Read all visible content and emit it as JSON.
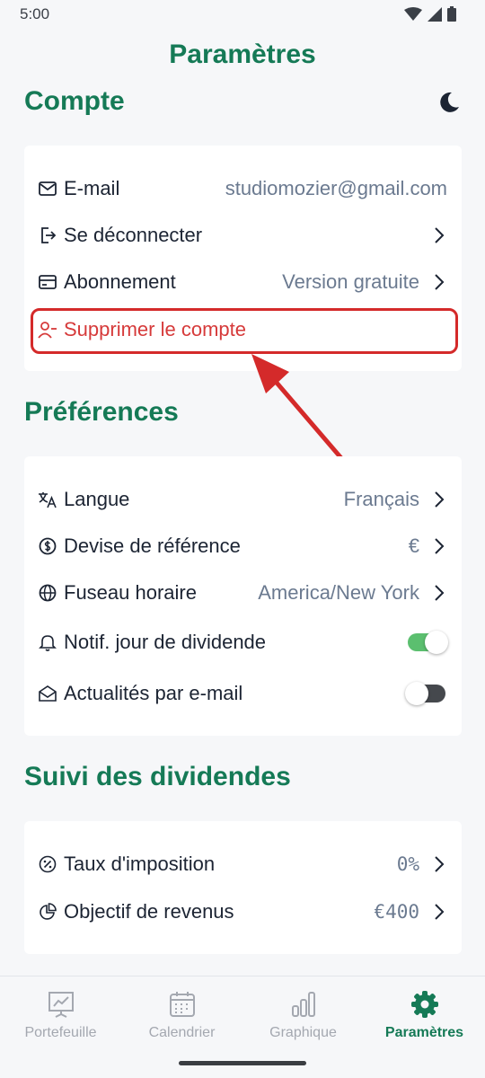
{
  "status_bar": {
    "time": "5:00"
  },
  "page_title": "Paramètres",
  "account": {
    "title": "Compte",
    "email_label": "E-mail",
    "email_value": "studiomozier@gmail.com",
    "logout_label": "Se déconnecter",
    "subscription_label": "Abonnement",
    "subscription_value": "Version gratuite",
    "delete_label": "Supprimer le compte"
  },
  "preferences": {
    "title": "Préférences",
    "language_label": "Langue",
    "language_value": "Français",
    "currency_label": "Devise de référence",
    "currency_value": "€",
    "timezone_label": "Fuseau horaire",
    "timezone_value": "America/New York",
    "dividend_notif_label": "Notif. jour de dividende",
    "dividend_notif_on": true,
    "email_news_label": "Actualités par e-mail",
    "email_news_on": false
  },
  "dividends": {
    "title": "Suivi des dividendes",
    "tax_label": "Taux d'imposition",
    "tax_value": "0%",
    "income_goal_label": "Objectif de revenus",
    "income_goal_value": "€400"
  },
  "nav": {
    "portfolio": "Portefeuille",
    "calendar": "Calendrier",
    "chart": "Graphique",
    "settings": "Paramètres"
  },
  "colors": {
    "brand_green": "#157a56",
    "danger_red": "#d63a3a",
    "highlight_red": "#d42a2a",
    "toggle_on": "#5bbf6f",
    "toggle_off": "#45484d"
  }
}
